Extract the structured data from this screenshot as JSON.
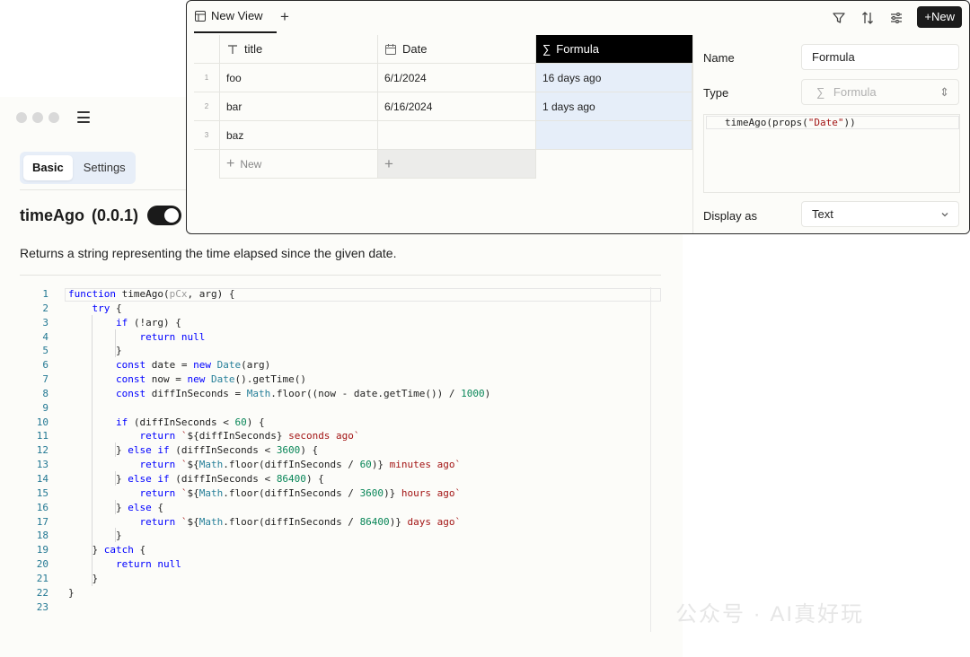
{
  "plugin": {
    "tabs": [
      "Basic",
      "Settings"
    ],
    "function_name": "timeAgo",
    "version": "(0.0.1)",
    "description": "Returns a string representing the time elapsed since the given date."
  },
  "code": [
    {
      "n": "1",
      "html": "<span class=\"kw\">function</span> timeAgo(<span class=\"hint\">pCx</span>, arg) {"
    },
    {
      "n": "2",
      "html": "    <span class=\"kw\">try</span> {"
    },
    {
      "n": "3",
      "html": "        <span class=\"kw\">if</span> (!arg) {"
    },
    {
      "n": "4",
      "html": "            <span class=\"kw\">return</span> <span class=\"kw\">null</span>"
    },
    {
      "n": "5",
      "html": "        }"
    },
    {
      "n": "6",
      "html": "        <span class=\"kw\">const</span> date = <span class=\"kw\">new</span> <span class=\"cls\">Date</span>(arg)"
    },
    {
      "n": "7",
      "html": "        <span class=\"kw\">const</span> now = <span class=\"kw\">new</span> <span class=\"cls\">Date</span>().getTime()"
    },
    {
      "n": "8",
      "html": "        <span class=\"kw\">const</span> diffInSeconds = <span class=\"cls\">Math</span>.floor((now - date.getTime()) / <span class=\"num\">1000</span>)"
    },
    {
      "n": "9",
      "html": ""
    },
    {
      "n": "10",
      "html": "        <span class=\"kw\">if</span> (diffInSeconds &lt; <span class=\"num\">60</span>) {"
    },
    {
      "n": "11",
      "html": "            <span class=\"kw\">return</span> <span class=\"str\">`</span>${diffInSeconds}<span class=\"str\"> seconds ago`</span>"
    },
    {
      "n": "12",
      "html": "        } <span class=\"kw\">else if</span> (diffInSeconds &lt; <span class=\"num\">3600</span>) {"
    },
    {
      "n": "13",
      "html": "            <span class=\"kw\">return</span> <span class=\"str\">`</span>${<span class=\"cls\">Math</span>.floor(diffInSeconds / <span class=\"num\">60</span>)}<span class=\"str\"> minutes ago`</span>"
    },
    {
      "n": "14",
      "html": "        } <span class=\"kw\">else if</span> (diffInSeconds &lt; <span class=\"num\">86400</span>) {"
    },
    {
      "n": "15",
      "html": "            <span class=\"kw\">return</span> <span class=\"str\">`</span>${<span class=\"cls\">Math</span>.floor(diffInSeconds / <span class=\"num\">3600</span>)}<span class=\"str\"> hours ago`</span>"
    },
    {
      "n": "16",
      "html": "        } <span class=\"kw\">else</span> {"
    },
    {
      "n": "17",
      "html": "            <span class=\"kw\">return</span> <span class=\"str\">`</span>${<span class=\"cls\">Math</span>.floor(diffInSeconds / <span class=\"num\">86400</span>)}<span class=\"str\"> days ago`</span>"
    },
    {
      "n": "18",
      "html": "        }"
    },
    {
      "n": "19",
      "html": "    } <span class=\"kw\">catch</span> {"
    },
    {
      "n": "20",
      "html": "        <span class=\"kw\">return</span> <span class=\"kw\">null</span>"
    },
    {
      "n": "21",
      "html": "    }"
    },
    {
      "n": "22",
      "html": "}"
    },
    {
      "n": "23",
      "html": ""
    }
  ],
  "database": {
    "view_tab": "New View",
    "new_button": "New",
    "columns": [
      "title",
      "Date",
      "Formula"
    ],
    "rows": [
      {
        "num": "1",
        "title": "foo",
        "date": "6/1/2024",
        "formula": "16 days ago"
      },
      {
        "num": "2",
        "title": "bar",
        "date": "6/16/2024",
        "formula": "1 days ago"
      },
      {
        "num": "3",
        "title": "baz",
        "date": "",
        "formula": ""
      }
    ],
    "add_row_label": "New"
  },
  "property_panel": {
    "name_label": "Name",
    "name_value": "Formula",
    "type_label": "Type",
    "type_value": "Formula",
    "formula_code_prefix": "timeAgo(props(",
    "formula_code_string": "\"Date\"",
    "formula_code_suffix": "))",
    "display_label": "Display as",
    "display_value": "Text"
  },
  "watermark": "公众号 · AI真好玩",
  "icons": [
    "table-icon",
    "plus-icon",
    "filter-icon",
    "sort-icon",
    "settings-sliders-icon",
    "text-type-icon",
    "calendar-icon",
    "sigma-icon",
    "chevron-up-down-icon",
    "chevron-down-icon",
    "hamburger-menu-icon"
  ]
}
